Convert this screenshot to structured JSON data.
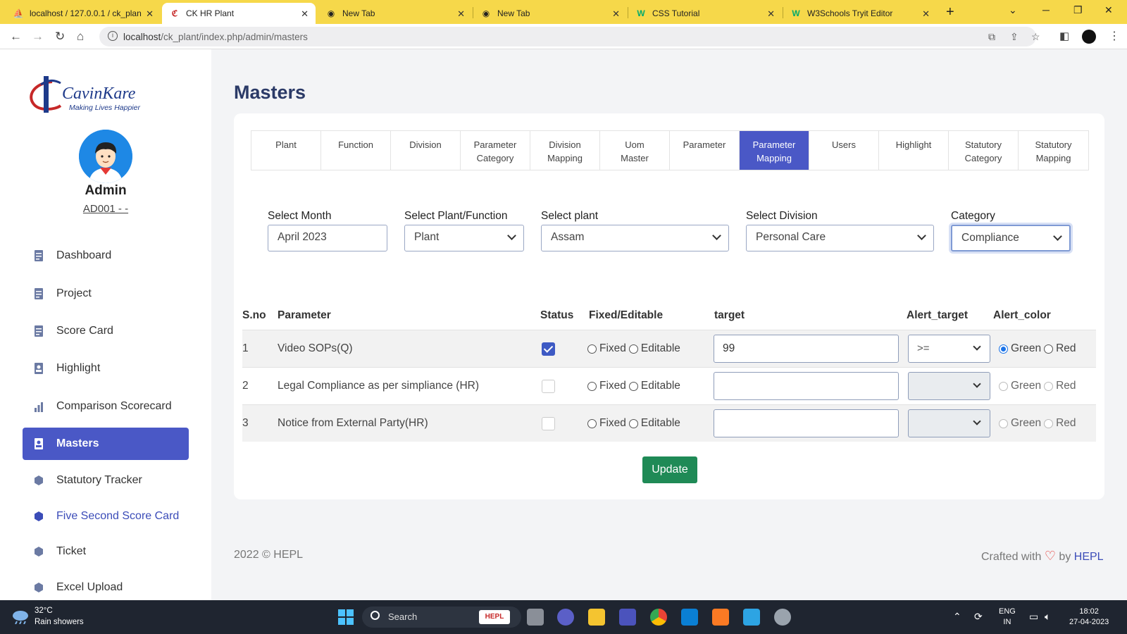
{
  "browser": {
    "tabs": [
      {
        "title": "localhost / 127.0.0.1 / ck_plan",
        "icon": "phpmyadmin-icon"
      },
      {
        "title": "CK HR Plant",
        "icon": "cavinkare-icon",
        "active": true
      },
      {
        "title": "New Tab",
        "icon": "chrome-icon"
      },
      {
        "title": "New Tab",
        "icon": "chrome-icon"
      },
      {
        "title": "CSS Tutorial",
        "icon": "w3schools-icon"
      },
      {
        "title": "W3Schools Tryit Editor",
        "icon": "w3schools-icon"
      }
    ],
    "url_host": "localhost",
    "url_path": "/ck_plant/index.php/admin/masters",
    "accent": "#f6d84a"
  },
  "sidebar": {
    "logo": {
      "brand": "CavinKare",
      "tagline": "Making Lives Happier"
    },
    "user_name": "Admin",
    "user_code": "AD001 - -",
    "items": [
      {
        "label": "Dashboard",
        "icon": "document-icon"
      },
      {
        "label": "Project",
        "icon": "document-icon"
      },
      {
        "label": "Score Card",
        "icon": "document-icon"
      },
      {
        "label": "Highlight",
        "icon": "badge-icon"
      },
      {
        "label": "Comparison Scorecard",
        "icon": "bar-chart-icon"
      },
      {
        "label": "Masters",
        "icon": "badge-icon",
        "active": true
      },
      {
        "label": "Statutory Tracker",
        "icon": "hexagon-icon"
      },
      {
        "label": "Five Second Score Card",
        "icon": "hexagon-icon"
      },
      {
        "label": "Ticket",
        "icon": "hexagon-icon"
      },
      {
        "label": "Excel Upload",
        "icon": "hexagon-icon"
      }
    ]
  },
  "main": {
    "title": "Masters",
    "tabs": [
      {
        "label": "Plant"
      },
      {
        "label": "Function"
      },
      {
        "label": "Division"
      },
      {
        "label": "Parameter Category"
      },
      {
        "label": "Division Mapping"
      },
      {
        "label": "Uom Master"
      },
      {
        "label": "Parameter"
      },
      {
        "label": "Parameter Mapping",
        "active": true
      },
      {
        "label": "Users"
      },
      {
        "label": "Highlight"
      },
      {
        "label": "Statutory Category"
      },
      {
        "label": "Statutory Mapping"
      }
    ],
    "filters": {
      "month": {
        "label": "Select Month",
        "value": "April 2023"
      },
      "plant_function": {
        "label": "Select Plant/Function",
        "value": "Plant"
      },
      "plant": {
        "label": "Select plant",
        "value": "Assam"
      },
      "division": {
        "label": "Select Division",
        "value": "Personal Care"
      },
      "category": {
        "label": "Category",
        "value": "Compliance"
      }
    },
    "table": {
      "headers": {
        "sno": "S.no",
        "parameter": "Parameter",
        "status": "Status",
        "fixed_editable": "Fixed/Editable",
        "target": "target",
        "alert_target": "Alert_target",
        "alert_color": "Alert_color"
      },
      "radio_labels": {
        "fixed": "Fixed",
        "editable": "Editable",
        "green": "Green",
        "red": "Red"
      },
      "rows": [
        {
          "sno": "1",
          "parameter": "Video SOPs(Q)",
          "status": true,
          "target": "99",
          "alert_target": ">=",
          "alert_color": "Green"
        },
        {
          "sno": "2",
          "parameter": "Legal Compliance as per simpliance (HR)",
          "status": false,
          "target": "",
          "alert_target": "",
          "alert_color": ""
        },
        {
          "sno": "3",
          "parameter": "Notice from External Party(HR)",
          "status": false,
          "target": "",
          "alert_target": "",
          "alert_color": ""
        }
      ]
    },
    "update_label": "Update"
  },
  "footer": {
    "left": "2022 © HEPL",
    "crafted": "Crafted with",
    "by": "by",
    "brand": "HEPL"
  },
  "taskbar": {
    "temp": "32°C",
    "weather": "Rain showers",
    "search_label": "Search",
    "search_badge": "HEPL",
    "lang": "ENG",
    "region": "IN",
    "time": "18:02",
    "date": "27-04-2023"
  }
}
